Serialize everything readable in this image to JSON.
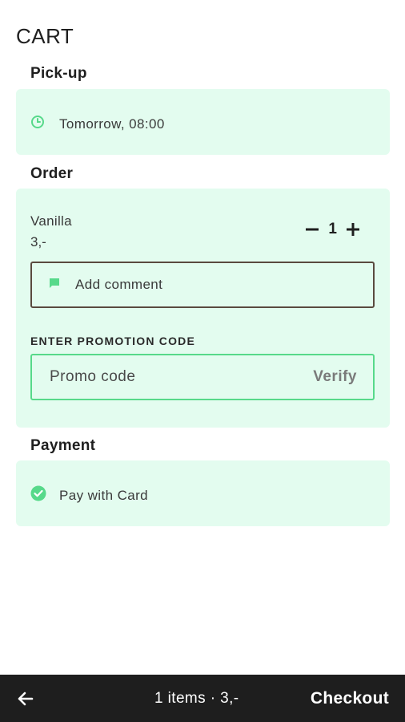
{
  "header": {
    "title": "CART"
  },
  "pickup": {
    "section_title": "Pick-up",
    "time": "Tomorrow, 08:00",
    "icon": "clock-icon"
  },
  "order": {
    "section_title": "Order",
    "items": [
      {
        "name": "Vanilla",
        "price": "3,-",
        "quantity": "1"
      }
    ],
    "comment": {
      "label": "Add comment",
      "icon": "comment-icon"
    },
    "promo": {
      "label": "ENTER PROMOTION CODE",
      "placeholder": "Promo code",
      "value": "",
      "verify_label": "Verify"
    }
  },
  "payment": {
    "section_title": "Payment",
    "method": "Pay with Card",
    "icon": "check-circle-icon"
  },
  "bottom_bar": {
    "summary": "1 items · 3,-",
    "checkout_label": "Checkout",
    "back_icon": "arrow-left-icon"
  },
  "colors": {
    "accent": "#57d98a",
    "card_bg": "#e3fcef",
    "bar_bg": "#1e1e1e"
  }
}
